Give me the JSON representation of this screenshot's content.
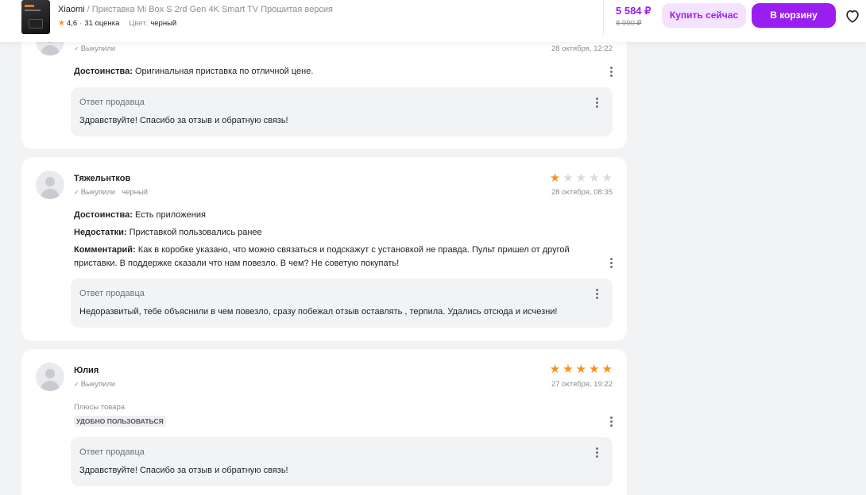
{
  "header": {
    "brand": "Xiaomi",
    "separator": " / ",
    "product_title": "Приставка Mi Box S 2rd Gen 4K Smart TV Прошитая версия",
    "rating": "4,6",
    "reviews_count": "31 оценка",
    "color_label": "Цвет:",
    "color_value": "черный",
    "price": "5 584 ₽",
    "old_price": "8 990 ₽",
    "buy_now_label": "Купить сейчас",
    "cart_label": "В корзину"
  },
  "reviews": [
    {
      "bought_label": "Выкупили",
      "date": "28 октября, 12:22",
      "fields": [
        {
          "label": "Достоинства:",
          "text": " Оригинальная приставка по отличной цене."
        }
      ],
      "reply": {
        "title": "Ответ продавца",
        "text": "Здравствуйте! Спасибо за отзыв и обратную связь!"
      }
    },
    {
      "author": "Тяжельнтков",
      "bought_label": "Выкупили",
      "color": "черный",
      "rating": 1,
      "date": "28 октября, 08:35",
      "fields": [
        {
          "label": "Достоинства:",
          "text": " Есть приложения"
        },
        {
          "label": "Недостатки:",
          "text": " Приставкой пользовались ранее"
        },
        {
          "label": "Комментарий:",
          "text": " Как в коробке указано, что можно связаться и подскажут с установкой не правда. Пульт пришел от другой приставки. В поддержке сказали что нам повезло. В чем? Не советую покупать!"
        }
      ],
      "reply": {
        "title": "Ответ продавца",
        "text": "Недоразвитый, тебе объяснили в чем повезло, сразу побежал отзыв оставлять , терпила. Удались отсюда и исчезни!"
      }
    },
    {
      "author": "Юлия",
      "bought_label": "Выкупили",
      "rating": 5,
      "date": "27 октября, 19:22",
      "pros_label": "Плюсы товара",
      "tag": "УДОБНО ПОЛЬЗОВАТЬСЯ",
      "reply": {
        "title": "Ответ продавца",
        "text": "Здравствуйте! Спасибо за отзыв и обратную связь!"
      }
    }
  ],
  "colors": {
    "accent": "#9b1ef0",
    "accent_light": "#f4e3ff",
    "star": "#f7921e",
    "page_bg": "#f2f3f5"
  }
}
